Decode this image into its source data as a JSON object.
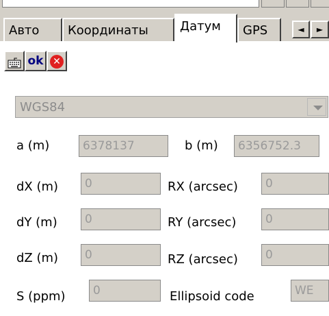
{
  "tabs": [
    {
      "label": "Авто"
    },
    {
      "label": "Координаты"
    },
    {
      "label": "Датум"
    },
    {
      "label": "GPS"
    }
  ],
  "active_tab": "Датум",
  "tab_scroll": {
    "left": "◄",
    "right": "►"
  },
  "toolbar": {
    "ok_label": "ok",
    "cancel_symbol": "✕"
  },
  "datum": {
    "selected": "WGS84"
  },
  "fields": {
    "a_label": "a (m)",
    "a_value": "6378137",
    "b_label": "b (m)",
    "b_value": "6356752.3",
    "dx_label": "dX (m)",
    "dx_value": "0",
    "dy_label": "dY (m)",
    "dy_value": "0",
    "dz_label": "dZ (m)",
    "dz_value": "0",
    "rx_label": "RX (arcsec)",
    "rx_value": "0",
    "ry_label": "RY (arcsec)",
    "ry_value": "0",
    "rz_label": "RZ (arcsec)",
    "rz_value": "0",
    "s_label": "S (ppm)",
    "s_value": "0",
    "ellipsoid_label": "Ellipsoid code",
    "ellipsoid_value": "WE"
  }
}
